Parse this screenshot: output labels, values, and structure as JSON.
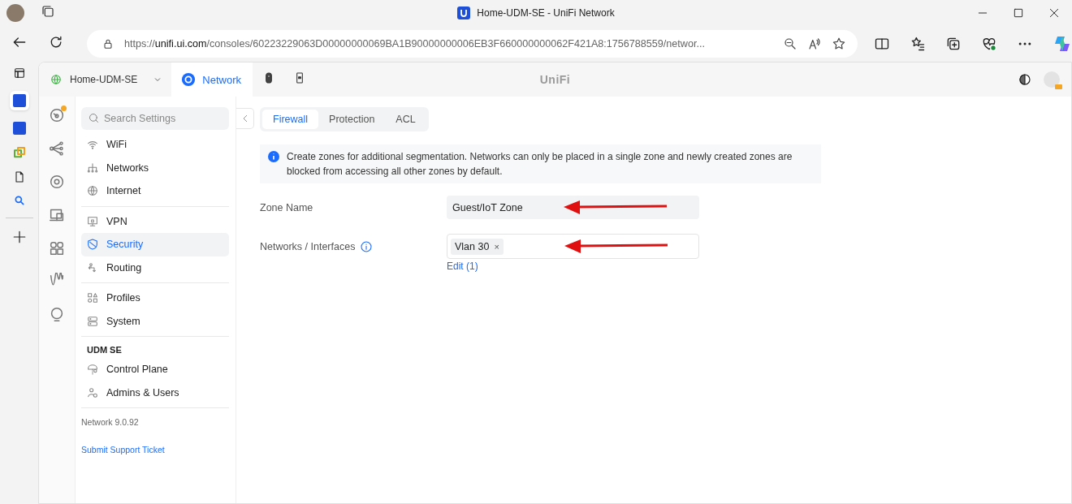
{
  "browser": {
    "title": "Home-UDM-SE - UniFi Network",
    "url": {
      "scheme": "https://",
      "host": "unifi.ui.com",
      "path": "/consoles/60223229063D00000000069BA1B90000000006EB3F660000000062F421A8:1756788559/networ..."
    }
  },
  "header": {
    "site": "Home-UDM-SE",
    "apps": [
      {
        "label": "Network",
        "selected": true
      }
    ],
    "logo": "UniFi"
  },
  "settings_nav": {
    "search": {
      "placeholder": "Search Settings"
    },
    "groups": [
      {
        "items": [
          {
            "label": "WiFi",
            "selected": false
          },
          {
            "label": "Networks",
            "selected": false
          },
          {
            "label": "Internet",
            "selected": false
          }
        ]
      },
      {
        "items": [
          {
            "label": "VPN",
            "selected": false
          },
          {
            "label": "Security",
            "selected": true
          },
          {
            "label": "Routing",
            "selected": false
          }
        ]
      },
      {
        "items": [
          {
            "label": "Profiles",
            "selected": false
          },
          {
            "label": "System",
            "selected": false
          }
        ]
      },
      {
        "heading": "UDM SE",
        "items": [
          {
            "label": "Control Plane",
            "selected": false
          },
          {
            "label": "Admins & Users",
            "selected": false
          }
        ]
      }
    ],
    "version": "Network 9.0.92",
    "support_link": "Submit Support Ticket"
  },
  "tabs": [
    {
      "label": "Firewall",
      "selected": true
    },
    {
      "label": "Protection",
      "selected": false
    },
    {
      "label": "ACL",
      "selected": false
    }
  ],
  "info": "Create zones for additional segmentation. Networks can only be placed in a single zone and newly created zones are blocked from accessing all other zones by default.",
  "form": {
    "zone_name": {
      "label": "Zone Name",
      "value": "Guest/IoT Zone"
    },
    "networks": {
      "label": "Networks / Interfaces",
      "chips": [
        {
          "label": "Vlan 30",
          "remove": "×"
        }
      ],
      "edit_link": "Edit (1)"
    }
  }
}
